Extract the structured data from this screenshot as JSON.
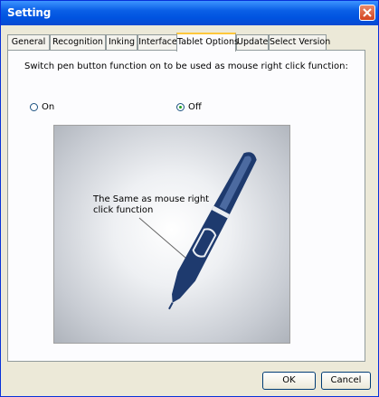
{
  "window": {
    "title": "Setting"
  },
  "tabs": [
    {
      "label": "General"
    },
    {
      "label": "Recognition"
    },
    {
      "label": "Inking"
    },
    {
      "label": "Interface"
    },
    {
      "label": "Tablet Options"
    },
    {
      "label": "Update"
    },
    {
      "label": "Select Version"
    }
  ],
  "active_tab": "Tablet Options",
  "panel": {
    "description": "Switch pen button function on to be used as mouse right click function:",
    "options": {
      "on": {
        "label": "On",
        "selected": false
      },
      "off": {
        "label": "Off",
        "selected": true
      }
    },
    "illustration": {
      "caption_line1": "The Same as mouse right",
      "caption_line2": "click function"
    }
  },
  "buttons": {
    "ok": "OK",
    "cancel": "Cancel"
  },
  "colors": {
    "titlebar": "#0a5fe6",
    "close_button": "#d4431f",
    "pen": "#1e3a6e",
    "tab_highlight": "#ffc83c"
  }
}
